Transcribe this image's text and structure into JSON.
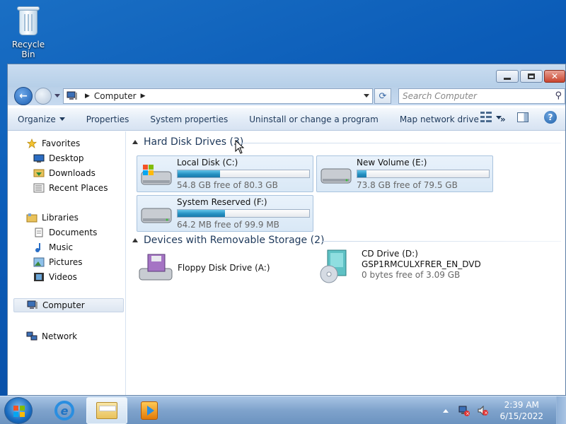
{
  "desktop": {
    "recycle_bin": "Recycle Bin"
  },
  "window": {
    "address": {
      "crumb": "Computer"
    },
    "search_placeholder": "Search Computer",
    "toolbar": {
      "organize": "Organize",
      "properties": "Properties",
      "system_properties": "System properties",
      "uninstall": "Uninstall or change a program",
      "map_drive": "Map network drive",
      "more": "»"
    },
    "nav": {
      "favorites": "Favorites",
      "desktop": "Desktop",
      "downloads": "Downloads",
      "recent": "Recent Places",
      "libraries": "Libraries",
      "documents": "Documents",
      "music": "Music",
      "pictures": "Pictures",
      "videos": "Videos",
      "computer": "Computer",
      "network": "Network"
    },
    "groups": {
      "hard": "Hard Disk Drives (3)",
      "removable": "Devices with Removable Storage (2)"
    },
    "drives": [
      {
        "name": "Local Disk (C:)",
        "free": "54.8 GB free of 80.3 GB",
        "used_fraction": 0.32
      },
      {
        "name": "New Volume (E:)",
        "free": "73.8 GB free of 79.5 GB",
        "used_fraction": 0.07
      },
      {
        "name": "System Reserved (F:)",
        "free": "64.2 MB free of 99.9 MB",
        "used_fraction": 0.36
      }
    ],
    "removable": {
      "floppy": "Floppy Disk Drive (A:)",
      "cd_name": "CD Drive (D:)",
      "cd_label": "GSP1RMCULXFRER_EN_DVD",
      "cd_free": "0 bytes free of 3.09 GB"
    }
  },
  "taskbar": {
    "time": "2:39 AM",
    "date": "6/15/2022"
  },
  "colors": {
    "accent": "#1e395b",
    "bar_fill": "#2590c2",
    "desktop": "#0b5cb8"
  }
}
